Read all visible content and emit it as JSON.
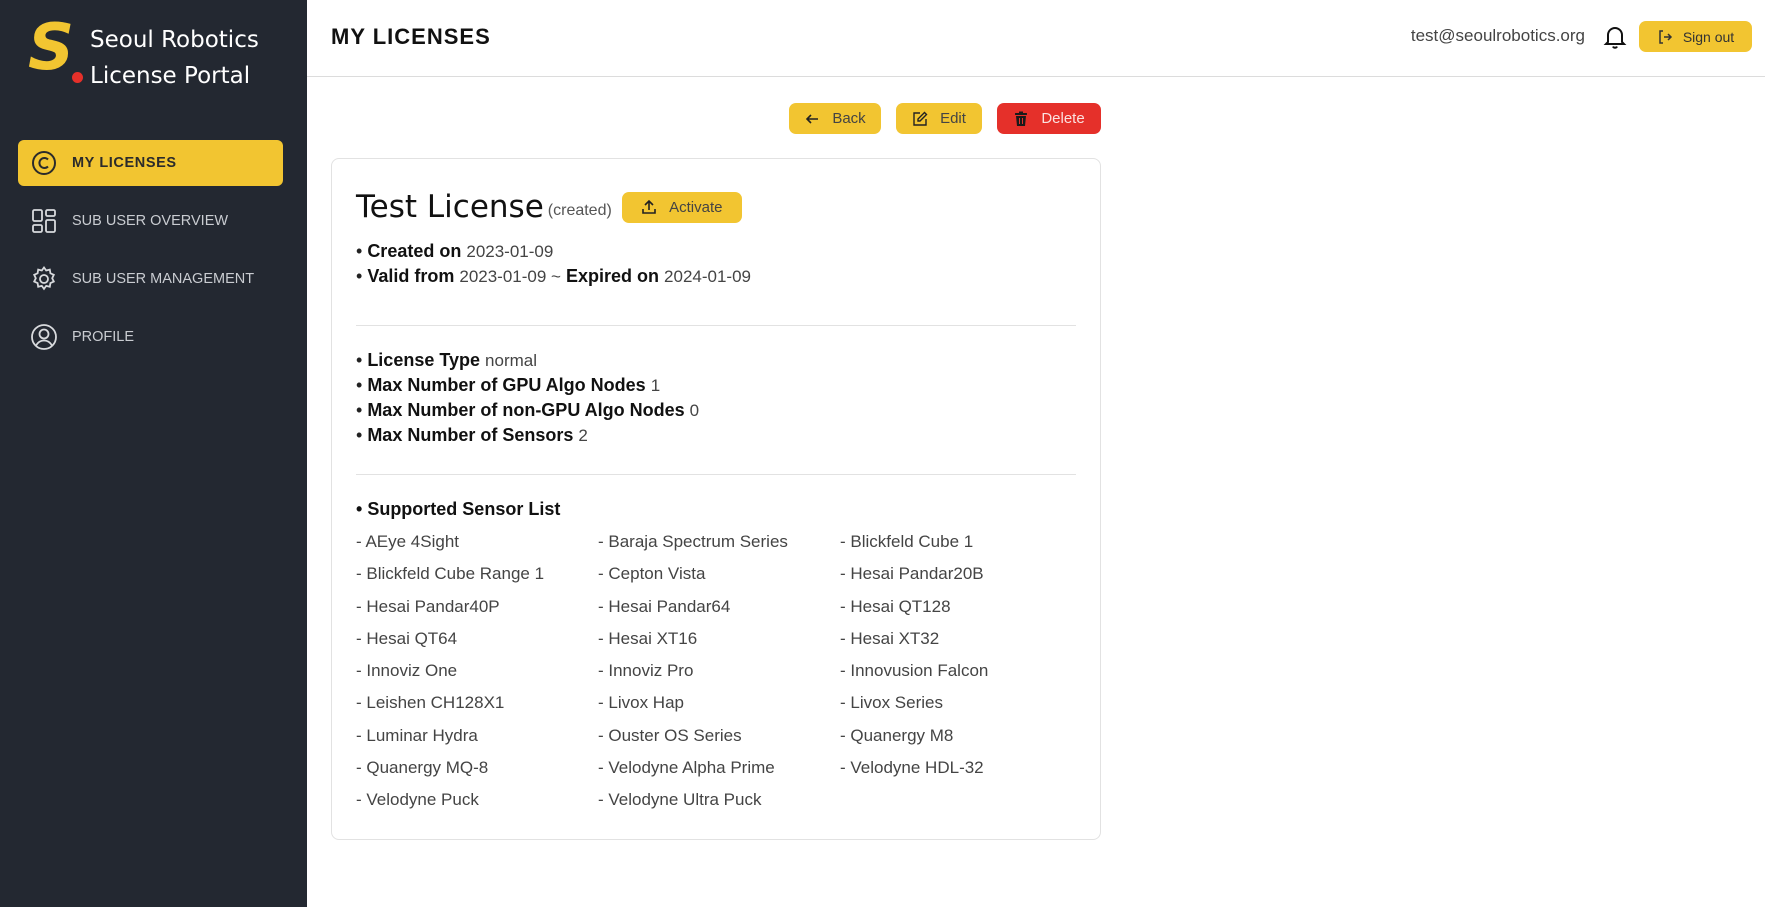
{
  "brand": {
    "line1": "Seoul Robotics",
    "line2": "License Portal",
    "logo_letter": "S"
  },
  "nav": [
    {
      "label": "MY LICENSES",
      "icon": "copyright-icon",
      "active": true
    },
    {
      "label": "SUB USER OVERVIEW",
      "icon": "grid-icon",
      "active": false
    },
    {
      "label": "SUB USER MANAGEMENT",
      "icon": "gear-icon",
      "active": false
    },
    {
      "label": "PROFILE",
      "icon": "user-circle-icon",
      "active": false
    }
  ],
  "header": {
    "title": "MY LICENSES",
    "email": "test@seoulrobotics.org",
    "signout_label": "Sign out"
  },
  "actions": {
    "back": "Back",
    "edit": "Edit",
    "delete": "Delete"
  },
  "license": {
    "name": "Test License",
    "status": "(created)",
    "activate_label": "Activate",
    "created_on_label": "Created on",
    "created_on": "2023-01-09",
    "valid_from_label": "Valid from",
    "valid_from": "2023-01-09 ~",
    "expired_on_label": "Expired on",
    "expired_on": "2024-01-09",
    "type_label": "License Type",
    "type": "normal",
    "gpu_label": "Max Number of GPU Algo Nodes",
    "gpu": "1",
    "nongpu_label": "Max Number of non-GPU Algo Nodes",
    "nongpu": "0",
    "sensors_label": "Max Number of Sensors",
    "sensors": "2",
    "sensor_list_label": "Supported Sensor List",
    "sensor_list": [
      "- AEye 4Sight",
      "- Baraja Spectrum Series",
      "- Blickfeld Cube 1",
      "- Blickfeld Cube Range 1",
      "- Cepton Vista",
      "- Hesai Pandar20B",
      "- Hesai Pandar40P",
      "- Hesai Pandar64",
      "- Hesai QT128",
      "- Hesai QT64",
      "- Hesai XT16",
      "- Hesai XT32",
      "- Innoviz One",
      "- Innoviz Pro",
      "- Innovusion Falcon",
      "- Leishen CH128X1",
      "- Livox Hap",
      "- Livox Series",
      "- Luminar Hydra",
      "- Ouster OS Series",
      "- Quanergy M8",
      "- Quanergy MQ-8",
      "- Velodyne Alpha Prime",
      "- Velodyne HDL-32",
      "- Velodyne Puck",
      "- Velodyne Ultra Puck"
    ]
  },
  "colors": {
    "accent": "#f2c531",
    "danger": "#e5302a",
    "sidebar": "#232831"
  }
}
